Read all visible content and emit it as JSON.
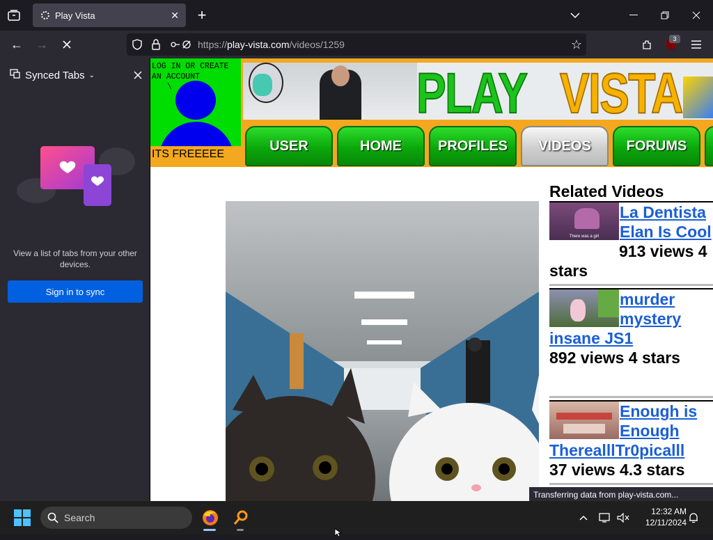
{
  "browser": {
    "tab_title": "Play Vista",
    "url_prefix": "https://",
    "url_host": "play-vista.com",
    "url_path": "/videos/1259",
    "extension_badge": "3"
  },
  "sidebar": {
    "title": "Synced Tabs",
    "description": "View a list of tabs from your other devices.",
    "sign_in_label": "Sign in to sync"
  },
  "site": {
    "login_prompt": "LOG IN OR CREATE AN ACCOUNT",
    "login_arrow": "\\",
    "free_text": "ITS FREEEEE",
    "logo_play": "PLAY",
    "logo_vista": "VISTA",
    "nav": [
      "USER",
      "HOME",
      "PROFILES",
      "VIDEOS",
      "FORUMS"
    ],
    "active_nav": "VIDEOS",
    "related_heading": "Related Videos",
    "related": [
      {
        "title": "La Dentista Elan Is Cool",
        "meta": "913 views 4 stars",
        "thumb_caption": "There was a girl"
      },
      {
        "title": "murder mystery insane JS1",
        "meta": "892 views 4 stars"
      },
      {
        "title": "Enough is Enough TherealllTr0picalll",
        "meta": "37 views 4.3 stars"
      }
    ]
  },
  "status_text": "Transferring data from play-vista.com...",
  "taskbar": {
    "search_placeholder": "Search",
    "time": "12:32 AM",
    "date": "12/11/2024"
  },
  "colors": {
    "accent_blue": "#0060df",
    "nav_green": "#0aa80a",
    "banner_orange": "#f3a81f",
    "link_blue": "#1a5fd6"
  }
}
